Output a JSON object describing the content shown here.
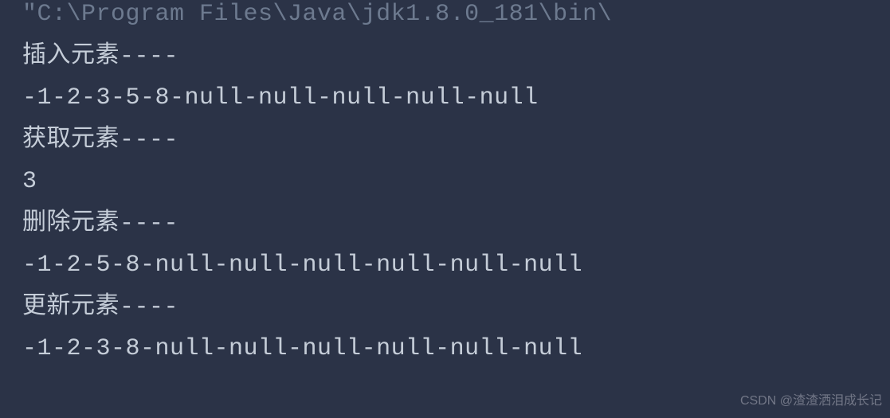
{
  "console": {
    "path": "\"C:\\Program Files\\Java\\jdk1.8.0_181\\bin\\",
    "lines": [
      "插入元素----",
      "-1-2-3-5-8-null-null-null-null-null",
      "获取元素----",
      "3",
      "删除元素----",
      "-1-2-5-8-null-null-null-null-null-null",
      "更新元素----",
      "-1-2-3-8-null-null-null-null-null-null"
    ]
  },
  "watermark": "CSDN @渣渣洒泪成长记"
}
